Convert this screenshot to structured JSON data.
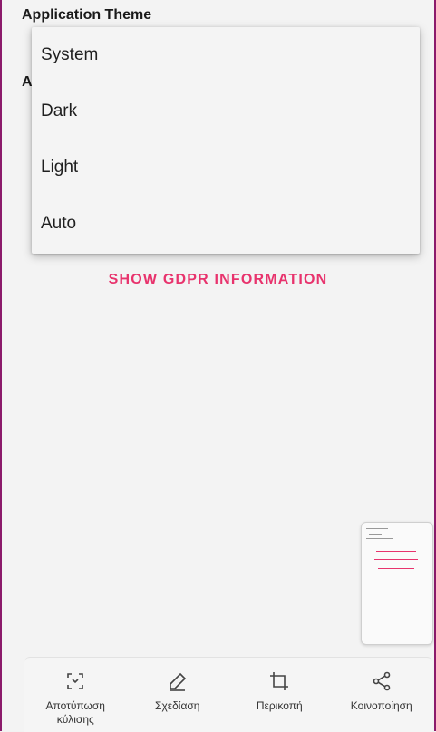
{
  "settings": {
    "section_title": "Application Theme",
    "hidden_next_section_initial": "A"
  },
  "theme_dropdown": {
    "options": [
      "System",
      "Dark",
      "Light",
      "Auto"
    ]
  },
  "gdpr_button_label": "SHOW GDPR INFORMATION",
  "screenshot_toolbar": {
    "actions": [
      {
        "label": "Αποτύπωση κύλισης",
        "icon": "scroll-capture-icon"
      },
      {
        "label": "Σχεδίαση",
        "icon": "pen-icon"
      },
      {
        "label": "Περικοπή",
        "icon": "crop-icon"
      },
      {
        "label": "Κοινοποίηση",
        "icon": "share-icon"
      }
    ]
  },
  "colors": {
    "accent": "#e8336d",
    "frame_border": "#8b1a6b",
    "background": "#f3f3f3"
  }
}
